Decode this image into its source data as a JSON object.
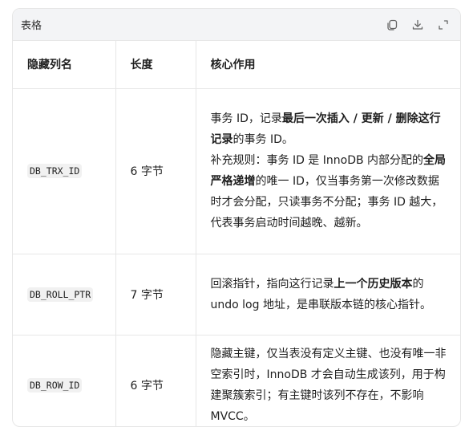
{
  "card": {
    "title": "表格",
    "icons": [
      "copy-icon",
      "download-icon",
      "expand-icon"
    ]
  },
  "table": {
    "headers": [
      "隐藏列名",
      "长度",
      "核心作用"
    ],
    "rows": [
      {
        "name": "DB_TRX_ID",
        "length": "6 字节",
        "desc": [
          {
            "t": "事务 ID，记录",
            "b": false
          },
          {
            "t": "最后一次插入 / 更新 / 删除这行记录",
            "b": true
          },
          {
            "t": "的事务 ID。",
            "b": false
          },
          {
            "t": "\n补充规则：事务 ID 是 InnoDB 内部分配的",
            "b": false
          },
          {
            "t": "全局严格递增",
            "b": true
          },
          {
            "t": "的唯一 ID，仅当事务第一次修改数据时才会分配，只读事务不分配；事务 ID 越大，代表事务启动时间越晚、越新。",
            "b": false
          }
        ]
      },
      {
        "name": "DB_ROLL_PTR",
        "length": "7 字节",
        "desc": [
          {
            "t": "回滚指针，指向这行记录",
            "b": false
          },
          {
            "t": "上一个历史版本",
            "b": true
          },
          {
            "t": "的 undo log 地址，是串联版本链的核心指针。",
            "b": false
          }
        ]
      },
      {
        "name": "DB_ROW_ID",
        "length": "6 字节",
        "desc": [
          {
            "t": "隐藏主键，仅当表没有定义主键、也没有唯一非空索引时，InnoDB 才会自动生成该列，用于构建聚簇索引；有主键时该列不存在，不影响 MVCC。",
            "b": false
          }
        ]
      }
    ]
  }
}
